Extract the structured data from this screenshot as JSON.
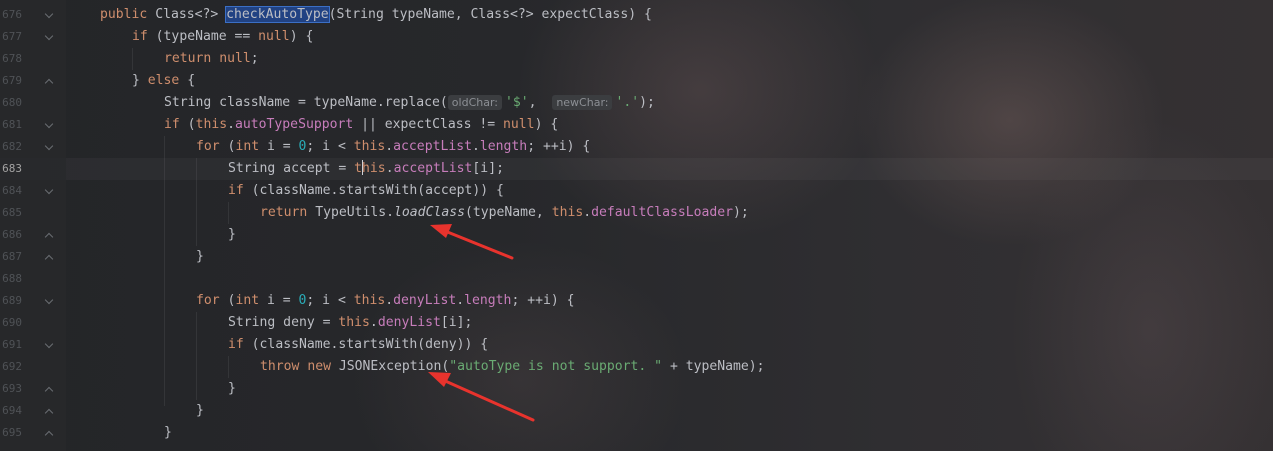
{
  "gutter": {
    "rows": [
      {
        "number": "676",
        "fold": "down",
        "current": false
      },
      {
        "number": "677",
        "fold": "down",
        "current": false
      },
      {
        "number": "678",
        "fold": "",
        "current": false
      },
      {
        "number": "679",
        "fold": "up",
        "current": false
      },
      {
        "number": "680",
        "fold": "",
        "current": false
      },
      {
        "number": "681",
        "fold": "down",
        "current": false
      },
      {
        "number": "682",
        "fold": "down",
        "current": false
      },
      {
        "number": "683",
        "fold": "",
        "current": true
      },
      {
        "number": "684",
        "fold": "down",
        "current": false
      },
      {
        "number": "685",
        "fold": "",
        "current": false
      },
      {
        "number": "686",
        "fold": "up",
        "current": false
      },
      {
        "number": "687",
        "fold": "up",
        "current": false
      },
      {
        "number": "688",
        "fold": "",
        "current": false
      },
      {
        "number": "689",
        "fold": "down",
        "current": false
      },
      {
        "number": "690",
        "fold": "",
        "current": false
      },
      {
        "number": "691",
        "fold": "down",
        "current": false
      },
      {
        "number": "692",
        "fold": "",
        "current": false
      },
      {
        "number": "693",
        "fold": "up",
        "current": false
      },
      {
        "number": "694",
        "fold": "up",
        "current": false
      },
      {
        "number": "695",
        "fold": "up",
        "current": false
      }
    ]
  },
  "editor": {
    "colors": {
      "keyword": "#cf8e6d",
      "field": "#c77dbb",
      "number": "#2aacb8",
      "string": "#6aab73",
      "plain": "#bcbec4",
      "selection": "#214283",
      "annotation_arrow": "#e8332d"
    },
    "lines": [
      {
        "indent": 0,
        "tokens": [
          {
            "t": "public",
            "c": "kw"
          },
          {
            "t": " Class<?> "
          },
          {
            "t": "checkAutoType",
            "c": "sel"
          },
          {
            "t": "(String typeName, Class<?> expectClass) {"
          }
        ]
      },
      {
        "indent": 1,
        "tokens": [
          {
            "t": "if",
            "c": "kw"
          },
          {
            "t": " (typeName == "
          },
          {
            "t": "null",
            "c": "kw"
          },
          {
            "t": ") {"
          }
        ]
      },
      {
        "indent": 2,
        "tokens": [
          {
            "t": "return",
            "c": "kw"
          },
          {
            "t": " "
          },
          {
            "t": "null",
            "c": "kw"
          },
          {
            "t": ";"
          }
        ]
      },
      {
        "indent": 1,
        "tokens": [
          {
            "t": "} "
          },
          {
            "t": "else",
            "c": "kw"
          },
          {
            "t": " {"
          }
        ]
      },
      {
        "indent": 2,
        "tokens": [
          {
            "t": "String className = typeName.replace("
          },
          {
            "t": "oldChar:",
            "c": "hint"
          },
          {
            "t": "'$'",
            "c": "str"
          },
          {
            "t": ",  "
          },
          {
            "t": "newChar:",
            "c": "hint"
          },
          {
            "t": "'.'",
            "c": "str"
          },
          {
            "t": ");"
          }
        ]
      },
      {
        "indent": 2,
        "tokens": [
          {
            "t": "if",
            "c": "kw"
          },
          {
            "t": " ("
          },
          {
            "t": "this",
            "c": "kw"
          },
          {
            "t": "."
          },
          {
            "t": "autoTypeSupport",
            "c": "fld"
          },
          {
            "t": " || expectClass != "
          },
          {
            "t": "null",
            "c": "kw"
          },
          {
            "t": ") {"
          }
        ]
      },
      {
        "indent": 3,
        "tokens": [
          {
            "t": "for",
            "c": "kw"
          },
          {
            "t": " ("
          },
          {
            "t": "int",
            "c": "kw"
          },
          {
            "t": " i = "
          },
          {
            "t": "0",
            "c": "num"
          },
          {
            "t": "; i < "
          },
          {
            "t": "this",
            "c": "kw"
          },
          {
            "t": "."
          },
          {
            "t": "acceptList",
            "c": "fld"
          },
          {
            "t": "."
          },
          {
            "t": "length",
            "c": "fld"
          },
          {
            "t": "; ++i) {"
          }
        ]
      },
      {
        "indent": 4,
        "tokens": [
          {
            "t": "String accept = "
          },
          {
            "t": "t",
            "c": "kw"
          },
          {
            "t": "",
            "c": "caret"
          },
          {
            "t": "his",
            "c": "kw"
          },
          {
            "t": "."
          },
          {
            "t": "acceptList",
            "c": "fld"
          },
          {
            "t": "[i];"
          }
        ]
      },
      {
        "indent": 4,
        "tokens": [
          {
            "t": "if",
            "c": "kw"
          },
          {
            "t": " (className.startsWith(accept)) {"
          }
        ]
      },
      {
        "indent": 5,
        "tokens": [
          {
            "t": "return",
            "c": "kw"
          },
          {
            "t": " TypeUtils."
          },
          {
            "t": "loadClass",
            "c": "fn-static"
          },
          {
            "t": "(typeName, "
          },
          {
            "t": "this",
            "c": "kw"
          },
          {
            "t": "."
          },
          {
            "t": "defaultClassLoader",
            "c": "fld"
          },
          {
            "t": ");"
          }
        ]
      },
      {
        "indent": 4,
        "tokens": [
          {
            "t": "}"
          }
        ]
      },
      {
        "indent": 3,
        "tokens": [
          {
            "t": "}"
          }
        ]
      },
      {
        "indent": 0,
        "tokens": [
          {
            "t": ""
          }
        ]
      },
      {
        "indent": 3,
        "tokens": [
          {
            "t": "for",
            "c": "kw"
          },
          {
            "t": " ("
          },
          {
            "t": "int",
            "c": "kw"
          },
          {
            "t": " i = "
          },
          {
            "t": "0",
            "c": "num"
          },
          {
            "t": "; i < "
          },
          {
            "t": "this",
            "c": "kw"
          },
          {
            "t": "."
          },
          {
            "t": "denyList",
            "c": "fld"
          },
          {
            "t": "."
          },
          {
            "t": "length",
            "c": "fld"
          },
          {
            "t": "; ++i) {"
          }
        ]
      },
      {
        "indent": 4,
        "tokens": [
          {
            "t": "String deny = "
          },
          {
            "t": "this",
            "c": "kw"
          },
          {
            "t": "."
          },
          {
            "t": "denyList",
            "c": "fld"
          },
          {
            "t": "[i];"
          }
        ]
      },
      {
        "indent": 4,
        "tokens": [
          {
            "t": "if",
            "c": "kw"
          },
          {
            "t": " (className.startsWith(deny)) {"
          }
        ]
      },
      {
        "indent": 5,
        "tokens": [
          {
            "t": "throw",
            "c": "kw"
          },
          {
            "t": " "
          },
          {
            "t": "new",
            "c": "kw"
          },
          {
            "t": " JSONException("
          },
          {
            "t": "\"autoType is not support. \"",
            "c": "str"
          },
          {
            "t": " + typeName);"
          }
        ]
      },
      {
        "indent": 4,
        "tokens": [
          {
            "t": "}"
          }
        ]
      },
      {
        "indent": 3,
        "tokens": [
          {
            "t": "}"
          }
        ]
      },
      {
        "indent": 2,
        "tokens": [
          {
            "t": "}"
          }
        ]
      }
    ]
  }
}
